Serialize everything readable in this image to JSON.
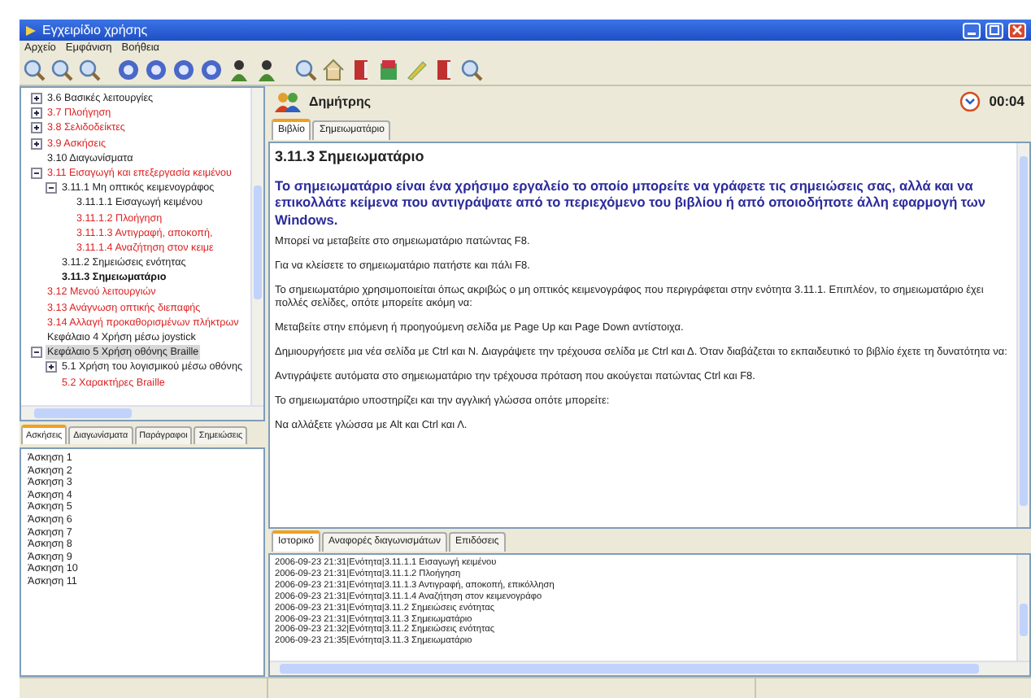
{
  "window": {
    "title": "Εγχειρίδιο χρήσης"
  },
  "menu": [
    "Αρχείο",
    "Εμφάνιση",
    "Βοήθεια"
  ],
  "tree": {
    "items": [
      {
        "children": [
          {
            "label": "3.6 Βασικές λειτουργίες",
            "visited": true,
            "selected": false,
            "expanded": false
          },
          {
            "label": "3.7 Πλοήγηση",
            "visited": false,
            "selected": false,
            "expanded": false
          },
          {
            "label": "3.8 Σελιδοδείκτες",
            "visited": false,
            "selected": false,
            "expanded": false
          },
          {
            "label": "3.9 Ασκήσεις",
            "visited": false,
            "selected": false,
            "expanded": false
          },
          {
            "label": "3.10 Διαγωνίσματα",
            "visited": true,
            "selected": false
          },
          {
            "label": "3.11 Εισαγωγή και επεξεργασία κειμένου",
            "visited": false,
            "selected": false,
            "expanded": true,
            "children": [
              {
                "label": "3.11.1 Μη οπτικός κειμενογράφος",
                "visited": true,
                "selected": false,
                "expanded": true,
                "children": [
                  {
                    "label": "3.11.1.1 Εισαγωγή κειμένου",
                    "visited": true,
                    "selected": false
                  },
                  {
                    "label": "3.11.1.2 Πλοήγηση",
                    "visited": false,
                    "selected": false
                  },
                  {
                    "label": "3.11.1.3 Αντιγραφή, αποκοπή,",
                    "visited": false,
                    "selected": false
                  },
                  {
                    "label": "3.11.1.4 Αναζήτηση στον κειμε",
                    "visited": false,
                    "selected": false
                  }
                ]
              },
              {
                "label": "3.11.2 Σημειώσεις ενότητας",
                "visited": true,
                "selected": false
              },
              {
                "label": "3.11.3 Σημειωματάριο",
                "visited": true,
                "selected": true
              }
            ]
          },
          {
            "label": "3.12 Μενού λειτουργιών",
            "visited": false,
            "selected": false
          },
          {
            "label": "3.13 Ανάγνωση οπτικής διεπαφής",
            "visited": false,
            "selected": false
          },
          {
            "label": "3.14 Αλλαγή προκαθορισμένων πλήκτρων",
            "visited": false,
            "selected": false
          }
        ]
      },
      {
        "label": "Κεφάλαιο 4 Χρήση μέσω joystick",
        "visited": true,
        "selected": false
      },
      {
        "label": "Κεφάλαιο 5 Χρήση οθόνης Braille",
        "visited": true,
        "selected": false,
        "highlighted": true,
        "expanded": true,
        "children": [
          {
            "label": "5.1 Χρήση του λογισμικού μέσω οθόνης",
            "visited": true,
            "selected": false,
            "expanded": false
          },
          {
            "label": "5.2 Χαρακτήρες Braille",
            "visited": false,
            "selected": false
          }
        ]
      }
    ]
  },
  "left_tabs": [
    {
      "label": "Ασκήσεις",
      "selected": true
    },
    {
      "label": "Διαγωνίσματα",
      "selected": false
    },
    {
      "label": "Παράγραφοι",
      "selected": false
    },
    {
      "label": "Σημειώσεις",
      "selected": false
    }
  ],
  "exercises": [
    "Άσκηση 1",
    "Άσκηση 2",
    "Άσκηση 3",
    "Άσκηση 4",
    "Άσκηση 5",
    "Άσκηση 6",
    "Άσκηση 7",
    "Άσκηση 8",
    "Άσκηση 9",
    "Άσκηση 10",
    "Άσκηση 11"
  ],
  "user": {
    "name": "Δημήτρης",
    "timer": "00:04"
  },
  "book_tabs": [
    {
      "label": "Βιβλίο",
      "selected": true
    },
    {
      "label": "Σημειωματάριο",
      "selected": false
    }
  ],
  "content": {
    "heading": "3.11.3 Σημειωματάριο",
    "intro": "Το σημειωματάριο είναι ένα χρήσιμο εργαλείο το οποίο μπορείτε να γράφετε τις σημειώσεις σας, αλλά και να επικολλάτε κείμενα που αντιγράψατε από το περιεχόμενο του βιβλίου ή από οποιοδήποτε άλλη εφαρμογή των Windows.",
    "paragraphs": [
      "Μπορεί να μεταβείτε στο σημειωματάριο πατώντας F8.",
      "Για να κλείσετε το σημειωματάριο πατήστε και πάλι F8.",
      "Το σημειωματάριο χρησιμοποιείται όπως ακριβώς ο μη οπτικός κειμενογράφος που περιγράφεται στην ενότητα 3.11.1. Επιπλέον, το σημειωματάριο έχει πολλές σελίδες, οπότε μπορείτε ακόμη να:",
      "Μεταβείτε στην επόμενη ή προηγούμενη σελίδα με Page Up και Page Down αντίστοιχα.",
      "Δημιουργήσετε μια νέα σελίδα με Ctrl και N. Διαγράψετε την τρέχουσα σελίδα με Ctrl και Δ. Όταν διαβάζεται το εκπαιδευτικό το βιβλίο έχετε τη δυνατότητα να:",
      "Αντιγράψετε αυτόματα στο σημειωματάριο την τρέχουσα πρόταση που ακούγεται πατώντας Ctrl και F8.",
      "Το σημειωματάριο υποστηρίζει και την αγγλική γλώσσα οπότε μπορείτε:",
      "Να αλλάξετε γλώσσα με Alt και Ctrl και Λ."
    ]
  },
  "bottom_tabs": [
    {
      "label": "Ιστορικό",
      "selected": true
    },
    {
      "label": "Αναφορές διαγωνισμάτων",
      "selected": false
    },
    {
      "label": "Επιδόσεις",
      "selected": false
    }
  ],
  "history": [
    "2006-09-23 21:31|Ενότητα|3.11.1.1 Εισαγωγή κειμένου",
    "2006-09-23 21:31|Ενότητα|3.11.1.2 Πλοήγηση",
    "2006-09-23 21:31|Ενότητα|3.11.1.3 Αντιγραφή, αποκοπή, επικόλληση",
    "2006-09-23 21:31|Ενότητα|3.11.1.4 Αναζήτηση στον κειμενογράφο",
    "2006-09-23 21:31|Ενότητα|3.11.2 Σημειώσεις ενότητας",
    "2006-09-23 21:31|Ενότητα|3.11.3 Σημειωματάριο",
    "2006-09-23 21:32|Ενότητα|3.11.2 Σημειώσεις ενότητας",
    "2006-09-23 21:35|Ενότητα|3.11.3 Σημειωματάριο"
  ]
}
